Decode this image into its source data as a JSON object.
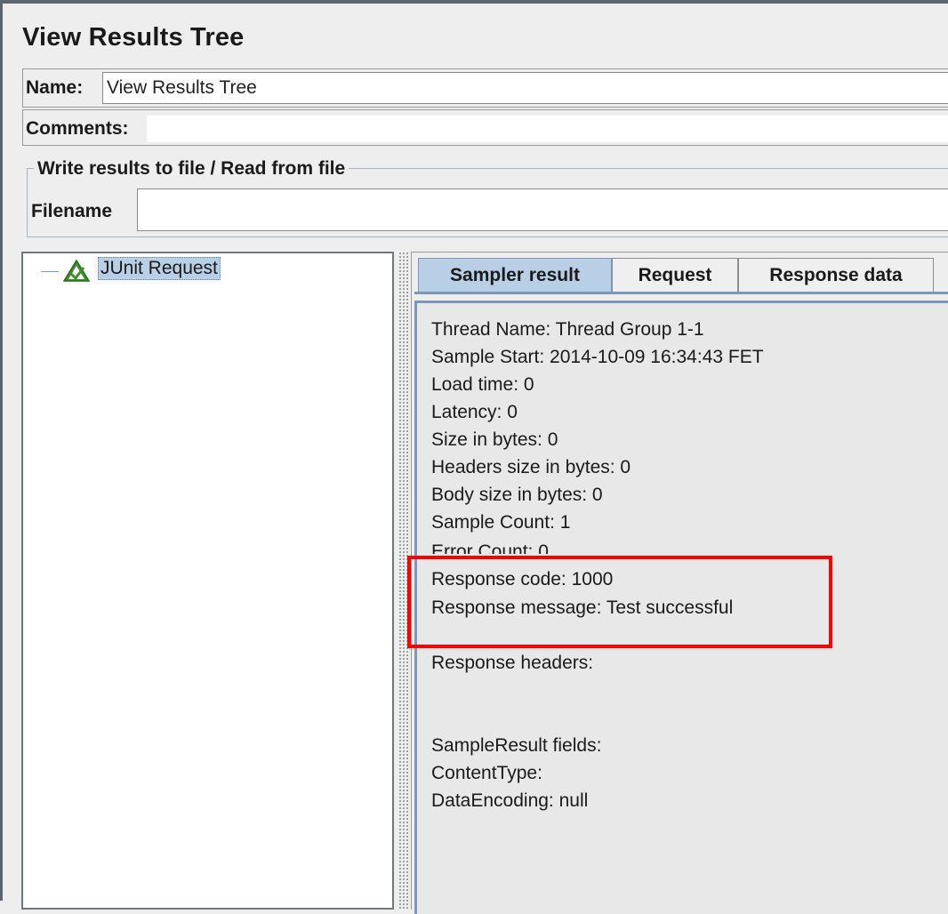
{
  "window": {
    "title": "View Results Tree"
  },
  "name_field": {
    "label": "Name:",
    "value": "View Results Tree"
  },
  "comments_field": {
    "label": "Comments:",
    "value": ""
  },
  "file_group": {
    "title": "Write results to file / Read from file",
    "filename_label": "Filename",
    "filename_value": ""
  },
  "tree": {
    "items": [
      {
        "label": "JUnit Request",
        "icon": "junit-success-icon",
        "selected": true
      }
    ]
  },
  "tabs": [
    {
      "label": "Sampler result",
      "active": true
    },
    {
      "label": "Request",
      "active": false
    },
    {
      "label": "Response data",
      "active": false
    }
  ],
  "sampler_result": {
    "lines": [
      "Thread Name: Thread Group 1-1",
      "Sample Start: 2014-10-09 16:34:43 FET",
      "Load time: 0",
      "Latency: 0",
      "Size in bytes: 0",
      "Headers size in bytes: 0",
      "Body size in bytes: 0",
      "Sample Count: 1",
      "Error Count: 0",
      "Response code: 1000",
      "Response message: Test successful",
      "Response headers:",
      "SampleResult fields:",
      "ContentType:",
      "DataEncoding: null"
    ]
  },
  "colors": {
    "highlight": "#ff0000",
    "selection": "#b8cfe5",
    "tab_active": "#b8cfe5"
  }
}
